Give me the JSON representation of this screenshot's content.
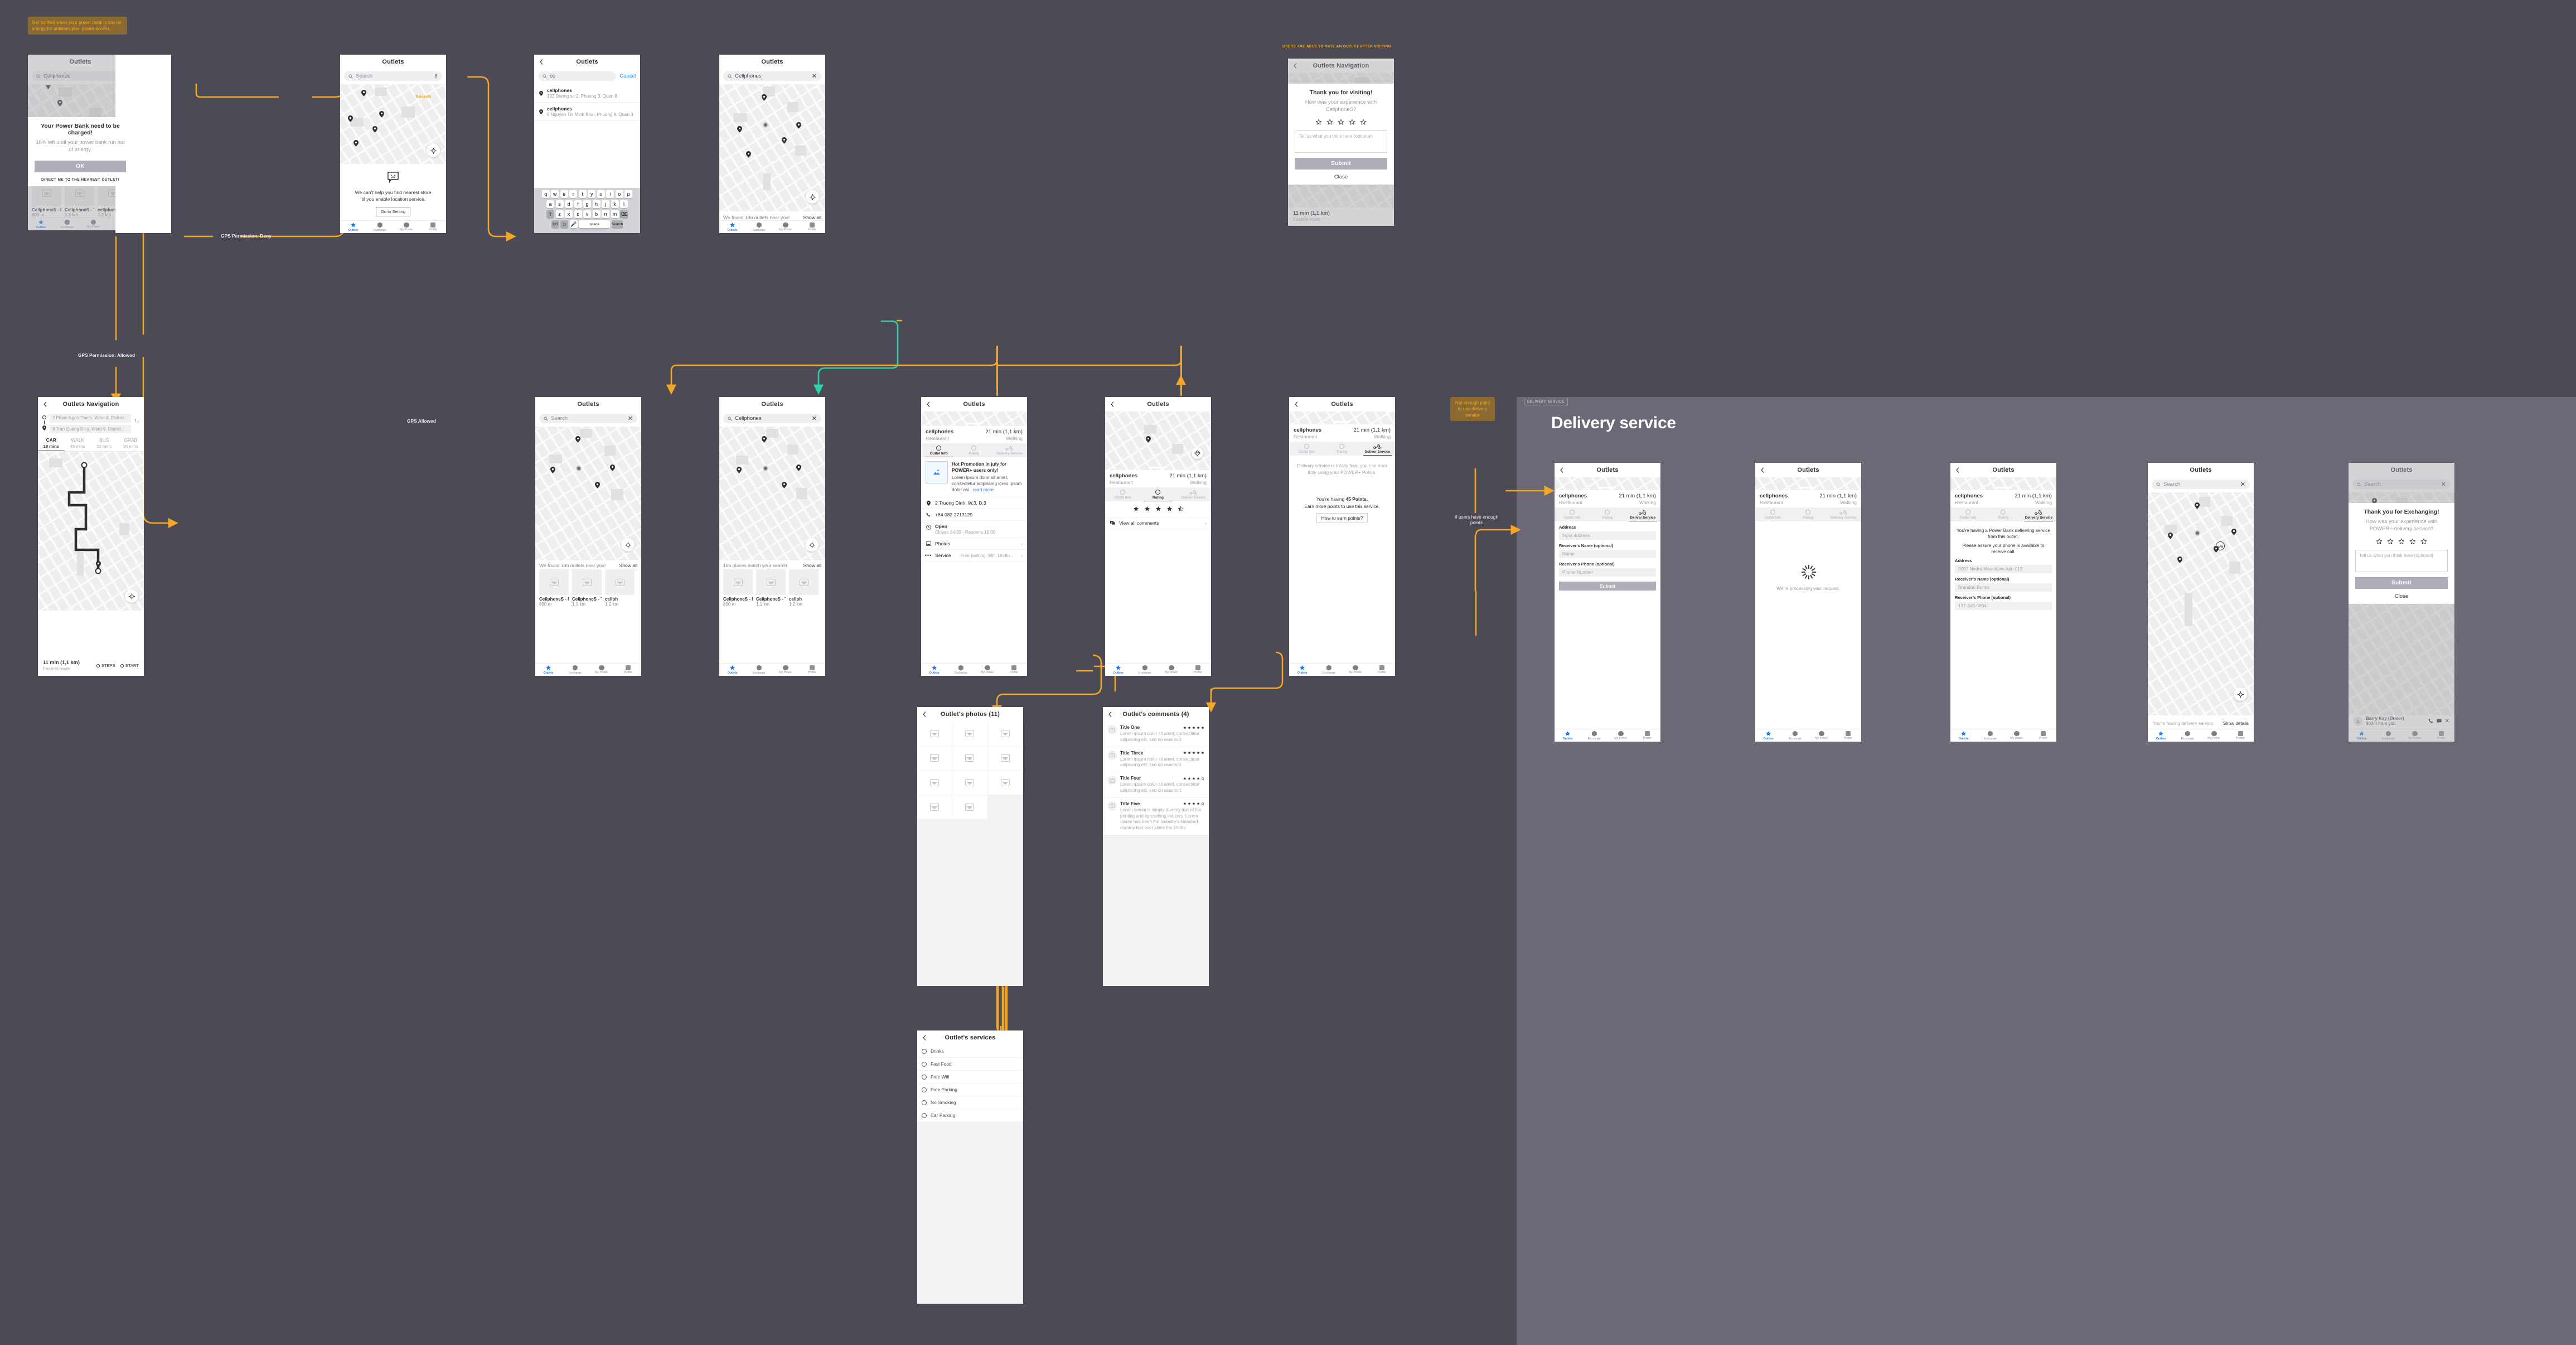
{
  "notes": {
    "power_bank_notify": "Get notified when your power bank is low on energy for uninterrupted power access.",
    "rate_after_visit": "USERS ARE ABLE TO RATE AN OUTLET AFTER VISITING",
    "not_enough_points": "Not enough point to use delivery service"
  },
  "flow_labels": {
    "gps_deny": "GPS Permission: Deny",
    "gps_allowed_1": "GPS Permission: Allowed",
    "gps_allowed_2": "GPS Allowed",
    "search": "Search",
    "if_enough_points": "If users have enough points"
  },
  "section": {
    "tag": "DELIVERY SERVICE",
    "title": "Delivery service"
  },
  "common": {
    "app_title": "Outlets",
    "search_placeholder": "Search",
    "back_icon": "chevron-left-icon",
    "close_icon": "close-icon",
    "tabbar": [
      {
        "label": "Outlets",
        "icon": "star-icon"
      },
      {
        "label": "Exchange",
        "icon": "hexagon-icon"
      },
      {
        "label": "My Power",
        "icon": "circle-icon"
      },
      {
        "label": "Profile",
        "icon": "square-icon"
      }
    ]
  },
  "screen_low_battery": {
    "title": "Outlets",
    "search_value": "Cellphones",
    "modal": {
      "heading": "Your Power Bank need to be charged!",
      "body": "10% left until your power bank run out of energy.",
      "ok": "OK",
      "cta": "DIRECT ME TO THE NEAREST OUTLET!"
    },
    "cards": [
      {
        "name": "CellphoneS - Ngu...",
        "distance": "800 m"
      },
      {
        "name": "CellphoneS - Tran..",
        "distance": "1.1 km"
      },
      {
        "name": "cellphones",
        "distance": "1.2 km"
      }
    ]
  },
  "screen_no_location": {
    "title": "Outlets",
    "search_placeholder": "Search",
    "empty_message_line1": "We can’t help you find nearest store",
    "empty_message_line2": "’til you enable location service.",
    "button": "Go to Setting"
  },
  "screen_search_typing": {
    "title": "Outlets",
    "search_value": "ce",
    "cancel": "Cancel",
    "suggestions": [
      {
        "name": "cellphones",
        "address": "192 Duong so 2, Phuong 3, Quan 8"
      },
      {
        "name": "cellphones",
        "address": "6 Nguyen Thi Minh Khai, Phuong 8, Quan 3"
      }
    ],
    "keyboard": {
      "row1": [
        "q",
        "w",
        "e",
        "r",
        "t",
        "y",
        "u",
        "i",
        "o",
        "p"
      ],
      "row2": [
        "a",
        "s",
        "d",
        "f",
        "g",
        "h",
        "j",
        "k",
        "l"
      ],
      "row3": [
        "z",
        "x",
        "c",
        "v",
        "b",
        "n",
        "m"
      ],
      "numbers": "123",
      "space": "space",
      "search": "Search"
    }
  },
  "screen_search_results_map": {
    "title": "Outlets",
    "search_value": "Cellphones",
    "found_text": "We found 186 outlets near you!",
    "show_all": "Show all"
  },
  "screen_navigation": {
    "title": "Outlets Navigation",
    "origin": "2 Pham Ngoc Thach, Ward 4, District...",
    "destination": "9 Tran Quang Dieu, Ward 9, District...",
    "swap_icon": "swap-vertical-icon",
    "modes": [
      {
        "name": "CAR",
        "time": "18 mins"
      },
      {
        "name": "WALK",
        "time": "45 mins"
      },
      {
        "name": "BUS",
        "time": "22 mins"
      },
      {
        "name": "GRAB",
        "time": "20 mins"
      }
    ],
    "eta": "11 min (1,1 km)",
    "eta_sub": "Fastest route.",
    "steps": "STEPS",
    "start": "START"
  },
  "screen_rate_outlet": {
    "title": "Outlets Navigation",
    "eta": "11 min (1,1 km)",
    "eta_sub": "Fastest route.",
    "modal": {
      "heading": "Thank you for visiting!",
      "body": "How was your experience with CellphoneS?",
      "textarea_placeholder": "Tell us what you think here (optional)",
      "submit": "Submit",
      "close": "Close",
      "stars": 5
    }
  },
  "screen_list_near": {
    "title": "Outlets",
    "search_placeholder": "Search",
    "found_text": "We found 186 outlets near you!",
    "show_all": "Show all",
    "cards": [
      {
        "name": "CellphoneS - Ngu...",
        "distance": "800 m"
      },
      {
        "name": "CellphoneS - Tran..",
        "distance": "1.1 km"
      },
      {
        "name": "cellph",
        "distance": "1.2 km"
      }
    ]
  },
  "screen_list_match": {
    "title": "Outlets",
    "search_value": "Cellphones",
    "found_text": "186 places match your search",
    "show_all": "Show all",
    "cards": [
      {
        "name": "CellphoneS - Ngu...",
        "distance": "800 m"
      },
      {
        "name": "CellphoneS - Tran..",
        "distance": "1.1 km"
      },
      {
        "name": "cellph",
        "distance": "1.2 km"
      }
    ]
  },
  "outlet_header": {
    "name": "cellphones",
    "category": "Restaurant",
    "eta": "21 min (1,1 km)",
    "mode": "Walking"
  },
  "outlet_tabs": [
    {
      "label": "Outlet Info",
      "icon": "circle-icon"
    },
    {
      "label": "Rating",
      "icon": "circle-icon"
    },
    {
      "label": "Delivery Service",
      "icon": "scooter-icon"
    }
  ],
  "screen_outlet_info": {
    "title": "Outlets",
    "promo_title": "Hot Promotion in july for POWER+ users only!",
    "promo_body": "Lorem ipsum dolor sit amet, consectetur adipiscing loreu ipsum dolor asi...",
    "promo_more": "read more",
    "address": "2 Truong Dinh, W.3, D.3",
    "phone": "+84 082 2713129",
    "open_status": "Open",
    "open_hours": "Closes 14:30 - Reopens 19:00",
    "photos_label": "Photos",
    "service_label": "Service",
    "service_value": "Free parking, Wifi, Drinks.."
  },
  "screen_outlet_rating": {
    "title": "Outlets",
    "rating": 4.5,
    "view_comments": "View all comments",
    "tab_delivery_short": "Deliver Service"
  },
  "screen_delivery_locked": {
    "title": "Outlets",
    "tab_delivery_short": "Deliver Service",
    "intro": "Delivery service is totally free, you can earn it by using your POWER+ Points.",
    "points_line_prefix": "You’re having ",
    "points_value": "45 Points.",
    "points_line_suffix": "Earn more points to use this service.",
    "button": "How to earn points?"
  },
  "screen_delivery_form": {
    "title": "Outlets",
    "tab_delivery_short": "Deliver Service",
    "fields": [
      {
        "label": "Address",
        "placeholder": "Input address"
      },
      {
        "label": "Receiver's Name (optional)",
        "placeholder": "Name"
      },
      {
        "label": "Receiver's Phone (optional)",
        "placeholder": "Phone Number"
      }
    ],
    "submit": "Submit"
  },
  "screen_delivery_processing": {
    "title": "Outlets",
    "message": "We’re processing your request."
  },
  "screen_delivery_confirmed": {
    "title": "Outlets",
    "tab_delivery_label": "Delivery Service",
    "headline": "You're having a Power Bank delivering service from this outlet.",
    "subline": "Please assure your phone is available to receive call.",
    "fields": [
      {
        "label": "Address",
        "value": "8007 Nedra Mountains Apt. 013"
      },
      {
        "label": "Receiver’s Name (optional)",
        "value": "Brandon Banks"
      },
      {
        "label": "Receiver’s Phone (optional)",
        "value": "137-345-5864"
      }
    ]
  },
  "screen_delivery_tracking": {
    "title": "Outlets",
    "search_placeholder": "Search",
    "status": "You're having delivery service.",
    "show_details": "Show details"
  },
  "screen_rate_delivery": {
    "title": "Outlets",
    "search_placeholder": "Search",
    "driver_name": "Barry Kay (Driver)",
    "driver_distance": "900m from you",
    "call_icon": "phone-icon",
    "chat_icon": "chat-icon",
    "cancel_icon": "close-icon",
    "modal": {
      "heading": "Thank you for Exchanging!",
      "body": "How was your experience with POWER+ delivery service?",
      "textarea_placeholder": "Tell us what you think here (optional)",
      "submit": "Submit",
      "close": "Close",
      "stars": 5
    }
  },
  "screen_photos": {
    "title": "Outlet's photos (11)",
    "count": 11
  },
  "screen_comments": {
    "title": "Outlet's comments (4)",
    "items": [
      {
        "title": "Title One",
        "body": "Lorem ipsum dolor sit amet, consectetur adipiscing elit, sed do eiusmod.",
        "stars": 5
      },
      {
        "title": "Title Three",
        "body": "Lorem ipsum dolor sit amet, consectetur adipiscing elit, sed do eiusmod.",
        "stars": 5
      },
      {
        "title": "Title Four",
        "body": "Lorem ipsum dolor sit amet, consectetur adipiscing elit, sed do eiusmod.",
        "stars": 4.5
      },
      {
        "title": "Title Five",
        "body": "Lorem Ipsum is simply dummy text of the printing and typesetting industry. Lorem Ipsum has been the industry's standard dummy text ever since the 1500s",
        "stars": 4.5
      }
    ]
  },
  "screen_services": {
    "title": "Outlet's services",
    "items": [
      "Drinks",
      "Fast Food",
      "Free Wifi",
      "Free Parking",
      "No Smoking",
      "Car Parking"
    ]
  },
  "colors": {
    "canvas": "#4b4a55",
    "section": "#6a6975",
    "accent": "#f5a623",
    "note_bg": "#8a6a30",
    "primary_blue": "#1a7cf0",
    "teal": "#2fd0b0"
  }
}
